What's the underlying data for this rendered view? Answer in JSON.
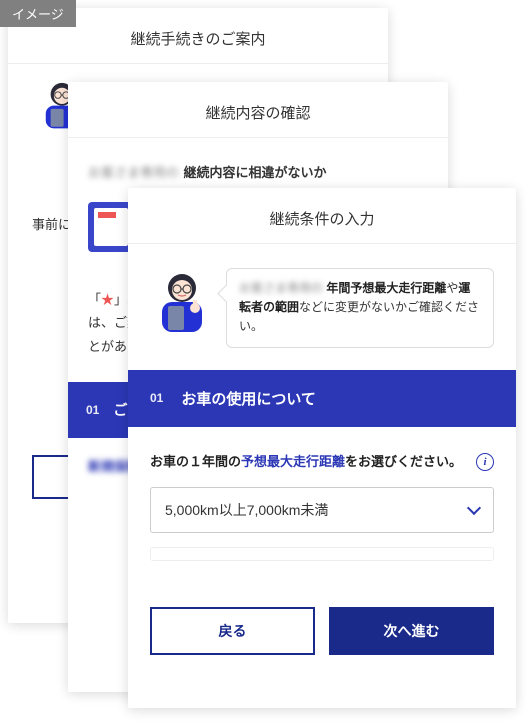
{
  "badge": "イメージ",
  "cards": {
    "back": {
      "title": "継続手続きのご案内",
      "pretext": "事前にご"
    },
    "mid": {
      "title": "継続内容の確認",
      "blur_prefix": "お客さま専用の",
      "suffix": "継続内容に相違がないか",
      "note_prefix": "「",
      "note_star": "★",
      "note_line1": "」印",
      "note_line2": "は、ご契",
      "note_line3": "とがあり",
      "band_num": "01",
      "band_title": "ご",
      "blur_bottom": "新規保険"
    },
    "front": {
      "title": "継続条件の入力",
      "bubble_blur": "お客さま専用の",
      "bubble_bold1": "年間予想最大走行距離",
      "bubble_mid": "や",
      "bubble_bold2": "運転者の範囲",
      "bubble_tail": "などに変更がないかご確認ください。",
      "section_num": "01",
      "section_title": "お車の使用について",
      "q_prefix": "お車の１年間の",
      "q_hl": "予想最大走行距離",
      "q_suffix": "をお選びください。",
      "select_value": "5,000km以上7,000km未満",
      "btn_back": "戻る",
      "btn_next": "次へ進む"
    }
  }
}
